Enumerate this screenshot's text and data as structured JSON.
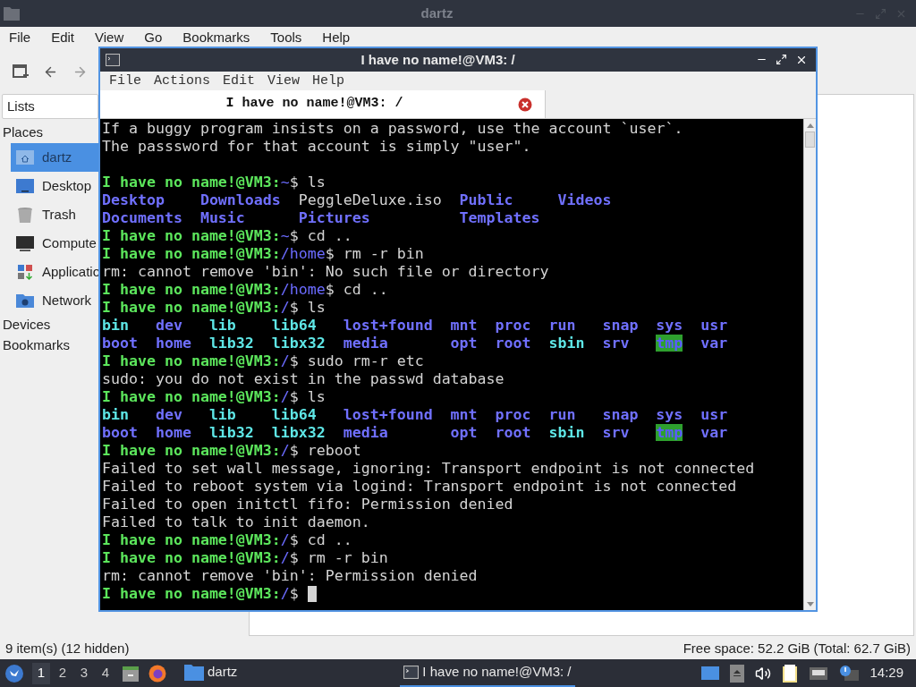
{
  "file_manager": {
    "title": "dartz",
    "menu": [
      "File",
      "Edit",
      "View",
      "Go",
      "Bookmarks",
      "Tools",
      "Help"
    ],
    "side_pane": {
      "selector": "Lists",
      "sections": [
        {
          "label": "Places",
          "items": [
            {
              "label": "dartz",
              "selected": true
            },
            {
              "label": "Desktop",
              "selected": false
            },
            {
              "label": "Trash",
              "selected": false
            },
            {
              "label": "Compute",
              "selected": false
            },
            {
              "label": "Applicatio",
              "selected": false
            },
            {
              "label": "Network",
              "selected": false
            }
          ]
        },
        {
          "label": "Devices"
        },
        {
          "label": "Bookmarks"
        }
      ]
    },
    "status_left": "9 item(s) (12 hidden)",
    "status_right": "Free space: 52.2 GiB (Total: 62.7 GiB)"
  },
  "terminal": {
    "title": "I have no name!@VM3: /",
    "menu": [
      "File",
      "Actions",
      "Edit",
      "View",
      "Help"
    ],
    "tabs": [
      {
        "label": "I have no name!@VM3: /",
        "selected": true
      }
    ],
    "cursor": true,
    "lines": [
      {
        "kind": "text",
        "segments": [
          {
            "text": "If a buggy program insists on a password, use the account `user`.",
            "kind": "plain"
          }
        ]
      },
      {
        "kind": "text",
        "segments": [
          {
            "text": "The passsword for that account is simply \"user\".",
            "kind": "plain"
          }
        ]
      },
      {
        "kind": "blank"
      },
      {
        "kind": "text",
        "segments": [
          {
            "text": "I have no name!@VM3:",
            "kind": "prompt"
          },
          {
            "text": "~",
            "kind": "path"
          },
          {
            "text": "$ ls",
            "kind": "plain"
          }
        ]
      },
      {
        "kind": "columns",
        "rows": [
          [
            {
              "text": "Desktop",
              "kind": "dir"
            },
            {
              "text": "Downloads",
              "kind": "dir"
            },
            {
              "text": "PeggleDeluxe.iso",
              "kind": "plain"
            },
            {
              "text": "Public",
              "kind": "dir"
            },
            {
              "text": "Videos",
              "kind": "dir"
            }
          ],
          [
            {
              "text": "Documents",
              "kind": "dir"
            },
            {
              "text": "Music",
              "kind": "dir"
            },
            {
              "text": "Pictures",
              "kind": "dir"
            },
            {
              "text": "Templates",
              "kind": "dir"
            }
          ]
        ]
      },
      {
        "kind": "text",
        "segments": [
          {
            "text": "I have no name!@VM3:",
            "kind": "prompt"
          },
          {
            "text": "~",
            "kind": "path"
          },
          {
            "text": "$ cd ..",
            "kind": "plain"
          }
        ]
      },
      {
        "kind": "text",
        "segments": [
          {
            "text": "I have no name!@VM3:",
            "kind": "prompt"
          },
          {
            "text": "/home",
            "kind": "path"
          },
          {
            "text": "$ rm -r bin",
            "kind": "plain"
          }
        ]
      },
      {
        "kind": "text",
        "segments": [
          {
            "text": "rm: cannot remove 'bin': No such file or directory",
            "kind": "plain"
          }
        ]
      },
      {
        "kind": "text",
        "segments": [
          {
            "text": "I have no name!@VM3:",
            "kind": "prompt"
          },
          {
            "text": "/home",
            "kind": "path"
          },
          {
            "text": "$ cd ..",
            "kind": "plain"
          }
        ]
      },
      {
        "kind": "text",
        "segments": [
          {
            "text": "I have no name!@VM3:",
            "kind": "prompt"
          },
          {
            "text": "/",
            "kind": "path"
          },
          {
            "text": "$ ls",
            "kind": "plain"
          }
        ]
      },
      {
        "kind": "columns",
        "rows": [
          [
            {
              "text": "bin",
              "kind": "link"
            },
            {
              "text": "dev",
              "kind": "dir"
            },
            {
              "text": "lib",
              "kind": "link"
            },
            {
              "text": "lib64",
              "kind": "link"
            },
            {
              "text": "lost+found",
              "kind": "dir"
            },
            {
              "text": "mnt",
              "kind": "dir"
            },
            {
              "text": "proc",
              "kind": "dir"
            },
            {
              "text": "run",
              "kind": "dir"
            },
            {
              "text": "snap",
              "kind": "dir"
            },
            {
              "text": "sys",
              "kind": "dir"
            },
            {
              "text": "usr",
              "kind": "dir"
            }
          ],
          [
            {
              "text": "boot",
              "kind": "dir"
            },
            {
              "text": "home",
              "kind": "dir"
            },
            {
              "text": "lib32",
              "kind": "link"
            },
            {
              "text": "libx32",
              "kind": "link"
            },
            {
              "text": "media",
              "kind": "dir"
            },
            {
              "text": "opt",
              "kind": "dir"
            },
            {
              "text": "root",
              "kind": "dir"
            },
            {
              "text": "sbin",
              "kind": "link"
            },
            {
              "text": "srv",
              "kind": "dir"
            },
            {
              "text": "tmp",
              "kind": "sticky"
            },
            {
              "text": "var",
              "kind": "dir"
            }
          ]
        ]
      },
      {
        "kind": "text",
        "segments": [
          {
            "text": "I have no name!@VM3:",
            "kind": "prompt"
          },
          {
            "text": "/",
            "kind": "path"
          },
          {
            "text": "$ sudo rm-r etc",
            "kind": "plain"
          }
        ]
      },
      {
        "kind": "text",
        "segments": [
          {
            "text": "sudo: you do not exist in the passwd database",
            "kind": "plain"
          }
        ]
      },
      {
        "kind": "text",
        "segments": [
          {
            "text": "I have no name!@VM3:",
            "kind": "prompt"
          },
          {
            "text": "/",
            "kind": "path"
          },
          {
            "text": "$ ls",
            "kind": "plain"
          }
        ]
      },
      {
        "kind": "columns",
        "rows": [
          [
            {
              "text": "bin",
              "kind": "link"
            },
            {
              "text": "dev",
              "kind": "dir"
            },
            {
              "text": "lib",
              "kind": "link"
            },
            {
              "text": "lib64",
              "kind": "link"
            },
            {
              "text": "lost+found",
              "kind": "dir"
            },
            {
              "text": "mnt",
              "kind": "dir"
            },
            {
              "text": "proc",
              "kind": "dir"
            },
            {
              "text": "run",
              "kind": "dir"
            },
            {
              "text": "snap",
              "kind": "dir"
            },
            {
              "text": "sys",
              "kind": "dir"
            },
            {
              "text": "usr",
              "kind": "dir"
            }
          ],
          [
            {
              "text": "boot",
              "kind": "dir"
            },
            {
              "text": "home",
              "kind": "dir"
            },
            {
              "text": "lib32",
              "kind": "link"
            },
            {
              "text": "libx32",
              "kind": "link"
            },
            {
              "text": "media",
              "kind": "dir"
            },
            {
              "text": "opt",
              "kind": "dir"
            },
            {
              "text": "root",
              "kind": "dir"
            },
            {
              "text": "sbin",
              "kind": "link"
            },
            {
              "text": "srv",
              "kind": "dir"
            },
            {
              "text": "tmp",
              "kind": "sticky"
            },
            {
              "text": "var",
              "kind": "dir"
            }
          ]
        ]
      },
      {
        "kind": "text",
        "segments": [
          {
            "text": "I have no name!@VM3:",
            "kind": "prompt"
          },
          {
            "text": "/",
            "kind": "path"
          },
          {
            "text": "$ reboot",
            "kind": "plain"
          }
        ]
      },
      {
        "kind": "text",
        "segments": [
          {
            "text": "Failed to set wall message, ignoring: Transport endpoint is not connected",
            "kind": "plain"
          }
        ]
      },
      {
        "kind": "text",
        "segments": [
          {
            "text": "Failed to reboot system via logind: Transport endpoint is not connected",
            "kind": "plain"
          }
        ]
      },
      {
        "kind": "text",
        "segments": [
          {
            "text": "Failed to open initctl fifo: Permission denied",
            "kind": "plain"
          }
        ]
      },
      {
        "kind": "text",
        "segments": [
          {
            "text": "Failed to talk to init daemon.",
            "kind": "plain"
          }
        ]
      },
      {
        "kind": "text",
        "segments": [
          {
            "text": "I have no name!@VM3:",
            "kind": "prompt"
          },
          {
            "text": "/",
            "kind": "path"
          },
          {
            "text": "$ cd ..",
            "kind": "plain"
          }
        ]
      },
      {
        "kind": "text",
        "segments": [
          {
            "text": "I have no name!@VM3:",
            "kind": "prompt"
          },
          {
            "text": "/",
            "kind": "path"
          },
          {
            "text": "$ rm -r bin",
            "kind": "plain"
          }
        ]
      },
      {
        "kind": "text",
        "segments": [
          {
            "text": "rm: cannot remove 'bin': Permission denied",
            "kind": "plain"
          }
        ]
      },
      {
        "kind": "text",
        "segments": [
          {
            "text": "I have no name!@VM3:",
            "kind": "prompt"
          },
          {
            "text": "/",
            "kind": "path"
          },
          {
            "text": "$",
            "kind": "plain"
          }
        ]
      }
    ]
  },
  "taskbar": {
    "workspaces": [
      {
        "label": "1",
        "selected": true
      },
      {
        "label": "2",
        "selected": false
      },
      {
        "label": "3",
        "selected": false
      },
      {
        "label": "4",
        "selected": false
      }
    ],
    "tasks": [
      {
        "label": "dartz",
        "kind": "folder",
        "selected": false
      },
      {
        "label": "I have no name!@VM3: /",
        "kind": "terminal",
        "selected": true
      }
    ],
    "clock": "14:29"
  }
}
